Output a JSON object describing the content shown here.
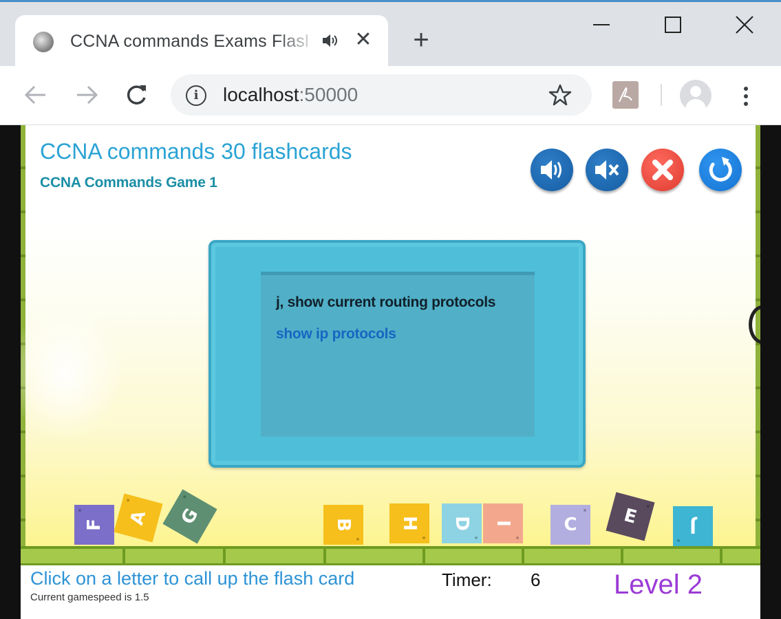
{
  "browser": {
    "tab_title": "CCNA commands Exams Flashcards",
    "url_host": "localhost",
    "url_port": ":50000",
    "new_tab_label": "+",
    "tab_close_label": "✕"
  },
  "game": {
    "title": "CCNA commands 30 flashcards",
    "subtitle": "CCNA Commands Game 1",
    "card": {
      "question": "j, show current routing protocols",
      "answer": "show ip protocols"
    },
    "tiles": [
      {
        "letter": "F",
        "color": "#7b6fc9"
      },
      {
        "letter": "A",
        "color": "#f6bf1c"
      },
      {
        "letter": "G",
        "color": "#5e8f72"
      },
      {
        "letter": "B",
        "color": "#f6bf1c"
      },
      {
        "letter": "H",
        "color": "#f6bf1c"
      },
      {
        "letter": "D",
        "color": "#8ed3e3"
      },
      {
        "letter": "I",
        "color": "#f3a88e"
      },
      {
        "letter": "C",
        "color": "#b3aee0"
      },
      {
        "letter": "E",
        "color": "#5a4a5e"
      },
      {
        "letter": "J",
        "color": "#3db5d3"
      }
    ],
    "status": {
      "hint": "Click on a letter to call up the flash card",
      "speed": "Current gamespeed is 1.5",
      "timer_label": "Timer:",
      "timer_value": "6",
      "level": "Level 2"
    },
    "controls": {
      "sound_icon": "speaker-icon",
      "mute_icon": "mute-icon",
      "close_icon": "close-icon",
      "restart_icon": "restart-icon"
    }
  }
}
